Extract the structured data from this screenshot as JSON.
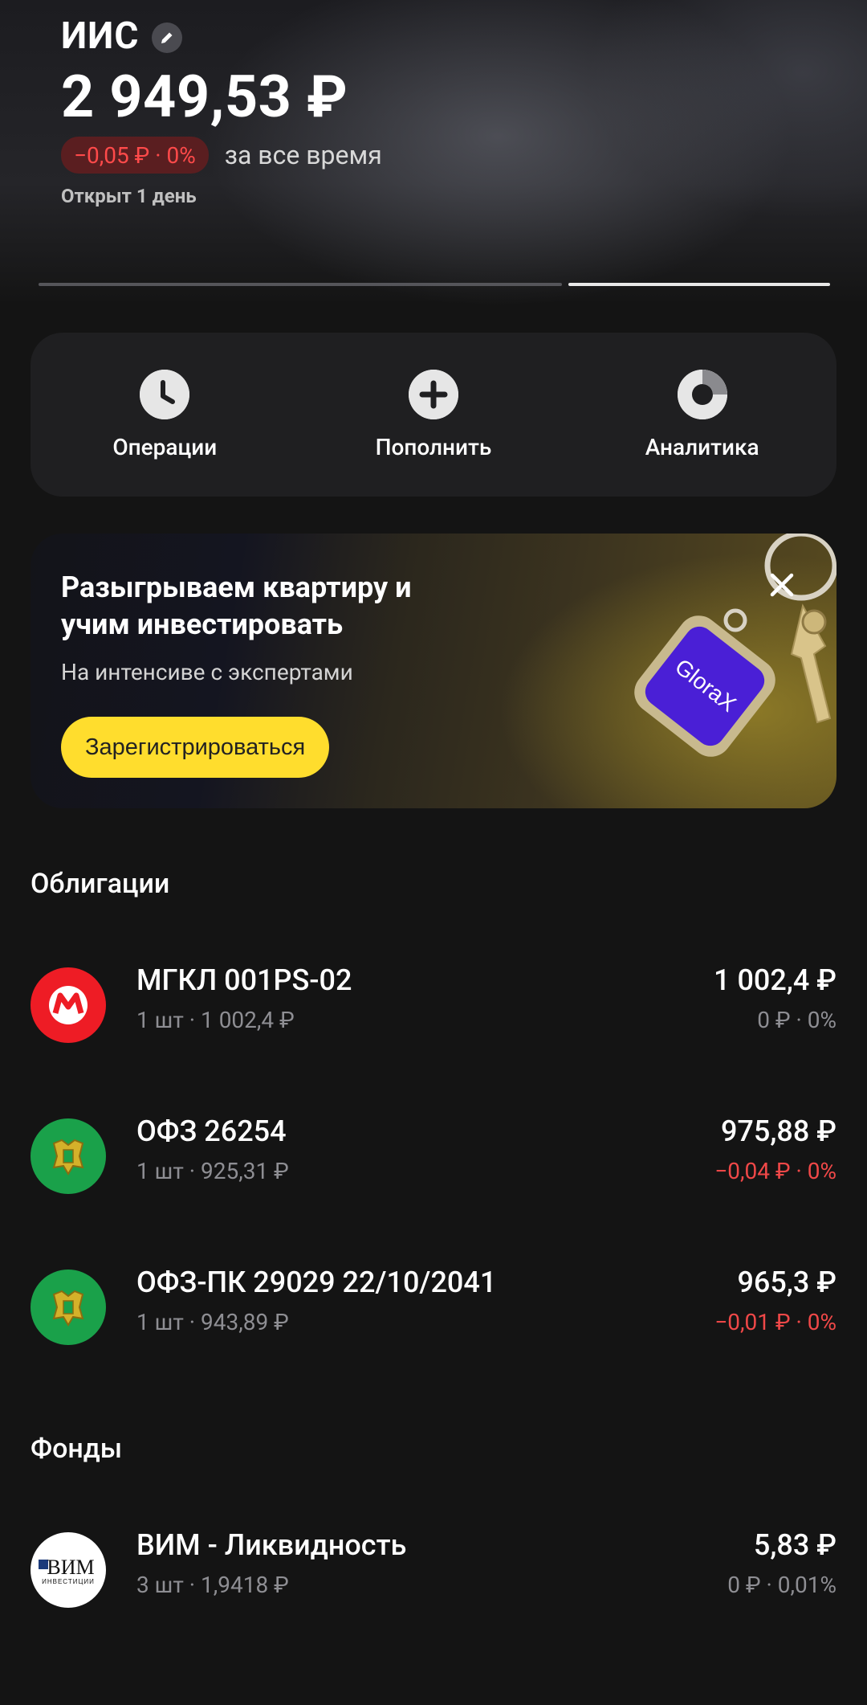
{
  "header": {
    "title": "ИИС",
    "balance": "2 949,53 ₽",
    "change_badge": "−0,05 ₽ · 0%",
    "change_period": "за все время",
    "opened": "Открыт 1 день"
  },
  "actions": [
    {
      "label": "Операции",
      "icon": "clock-icon"
    },
    {
      "label": "Пополнить",
      "icon": "plus-icon"
    },
    {
      "label": "Аналитика",
      "icon": "donut-chart-icon"
    }
  ],
  "banner": {
    "title": "Разыгрываем квартиру и учим инвестировать",
    "subtitle": "На интенсиве с экспертами",
    "button": "Зарегистрироваться",
    "keychain_text": "GloraX"
  },
  "sections": {
    "bonds": "Облигации",
    "funds": "Фонды"
  },
  "bonds": [
    {
      "name": "МГКЛ 001PS-02",
      "sub": "1 шт · 1 002,4 ₽",
      "price": "1 002,4 ₽",
      "delta": "0 ₽ · 0%",
      "logo_letter": "М"
    },
    {
      "name": "ОФЗ 26254",
      "sub": "1 шт · 925,31 ₽",
      "price": "975,88 ₽",
      "delta": "−0,04 ₽ · 0%"
    },
    {
      "name": "ОФЗ-ПК 29029 22/10/2041",
      "sub": "1 шт · 943,89 ₽",
      "price": "965,3 ₽",
      "delta": "−0,01 ₽ · 0%"
    }
  ],
  "funds": [
    {
      "name": "ВИМ - Ликвидность",
      "sub": "3 шт · 1,9418 ₽",
      "price": "5,83 ₽",
      "delta": "0 ₽ · 0,01%",
      "logo_text": "ВИМ",
      "logo_subtext": "ИНВЕСТИЦИИ"
    }
  ],
  "colors": {
    "accent_yellow": "#ffdd2d",
    "negative": "#f04848",
    "muted": "#8e8e93",
    "background": "#141414"
  }
}
